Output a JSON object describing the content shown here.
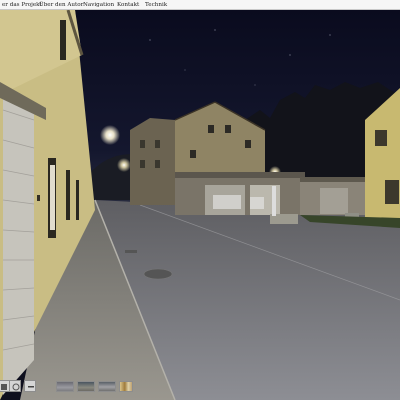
{
  "menu": {
    "items": [
      {
        "label": "er das Projekt"
      },
      {
        "label": "Über den Autor"
      },
      {
        "label": "Navigation"
      },
      {
        "label": "Kontakt"
      },
      {
        "label": "Technik"
      }
    ]
  },
  "panorama": {
    "scene": "night street with houses, street lamps and garage"
  },
  "toolbar": {
    "icons": [
      "first-icon",
      "map-icon",
      "minus-icon"
    ],
    "thumbnails": [
      "scene-thumb-1",
      "scene-thumb-2",
      "scene-thumb-3",
      "scene-thumb-4"
    ]
  }
}
